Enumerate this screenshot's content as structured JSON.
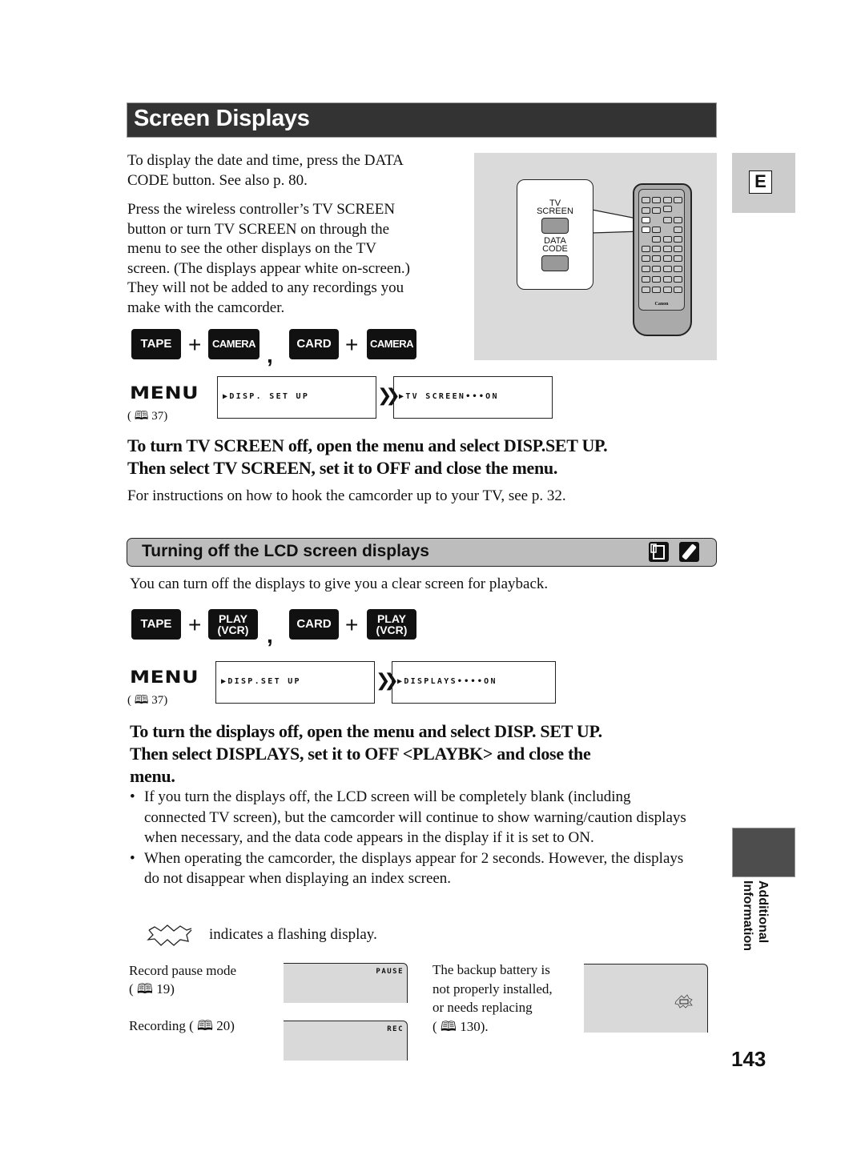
{
  "page": {
    "title": "Screen Displays",
    "language_tab": "E",
    "side_tab": [
      "Additional",
      "Information"
    ],
    "page_number": "143"
  },
  "intro": {
    "paragraph1": [
      "To display the date and time, press the DATA",
      "CODE button. See also p. 80."
    ],
    "paragraph2": [
      "Press the wireless controller’s TV SCREEN",
      "button or turn TV SCREEN on through the",
      "menu to see the other displays on the TV",
      "screen. (The displays appear white on-screen.)",
      "They will not be added to any recordings you",
      "make with the camcorder."
    ]
  },
  "illustration": {
    "button1_label": [
      "TV",
      "SCREEN"
    ],
    "button2_label": [
      "DATA",
      "CODE"
    ],
    "brand": "Canon"
  },
  "section1": {
    "modes": [
      {
        "left": "TAPE",
        "right": "CAMERA"
      },
      {
        "left": "CARD",
        "right": "CAMERA"
      }
    ],
    "plus": "+",
    "comma": ",",
    "menu_word": "MENU",
    "menu_ref": "( 🕮 37)",
    "menu_ref_text": "37)",
    "menu_steps": [
      "▶DISP. SET UP",
      "▶TV SCREEN•••ON"
    ],
    "instruction": [
      "To turn TV SCREEN off, open the menu and select DISP.SET UP.",
      "Then select TV SCREEN, set it to OFF and close the menu."
    ],
    "note": "For instructions on how to hook the camcorder up to your TV, see p. 32."
  },
  "section2": {
    "header": "Turning off the LCD screen displays",
    "header_icons": [
      "camcorder-lcd-icon",
      "wireless-controller-icon"
    ],
    "intro": "You can turn off the displays to give you a clear screen for playback.",
    "modes": [
      {
        "left": "TAPE",
        "right_line1": "PLAY",
        "right_line2": "(VCR)"
      },
      {
        "left": "CARD",
        "right_line1": "PLAY",
        "right_line2": "(VCR)"
      }
    ],
    "menu_word": "MENU",
    "menu_ref_text": "37)",
    "menu_steps": [
      "▶DISP.SET UP",
      "▶DISPLAYS••••ON"
    ],
    "instruction": [
      "To turn the displays off, open the menu and select DISP. SET UP.",
      "Then select DISPLAYS, set it to OFF <PLAYBK> and close the",
      "menu."
    ],
    "bullets": [
      "If you turn the displays off, the LCD screen will be completely blank (including connected TV screen), but the camcorder will continue to show warning/caution displays when necessary, and the data code appears in the display if it is set to ON.",
      "When operating the camcorder, the displays appear for 2 seconds. However, the displays do not disappear when displaying an index screen."
    ],
    "flash_legend": "indicates a flashing display.",
    "examples": [
      {
        "label_line1": "Record pause mode",
        "label_ref": "19)",
        "screen_text": "PAUSE"
      },
      {
        "label_line1": "Recording (",
        "label_ref": "20)",
        "screen_text": "REC"
      }
    ],
    "battery_note": [
      "The backup battery is",
      "not properly installed,",
      "or needs replacing"
    ],
    "battery_ref": "130)."
  }
}
